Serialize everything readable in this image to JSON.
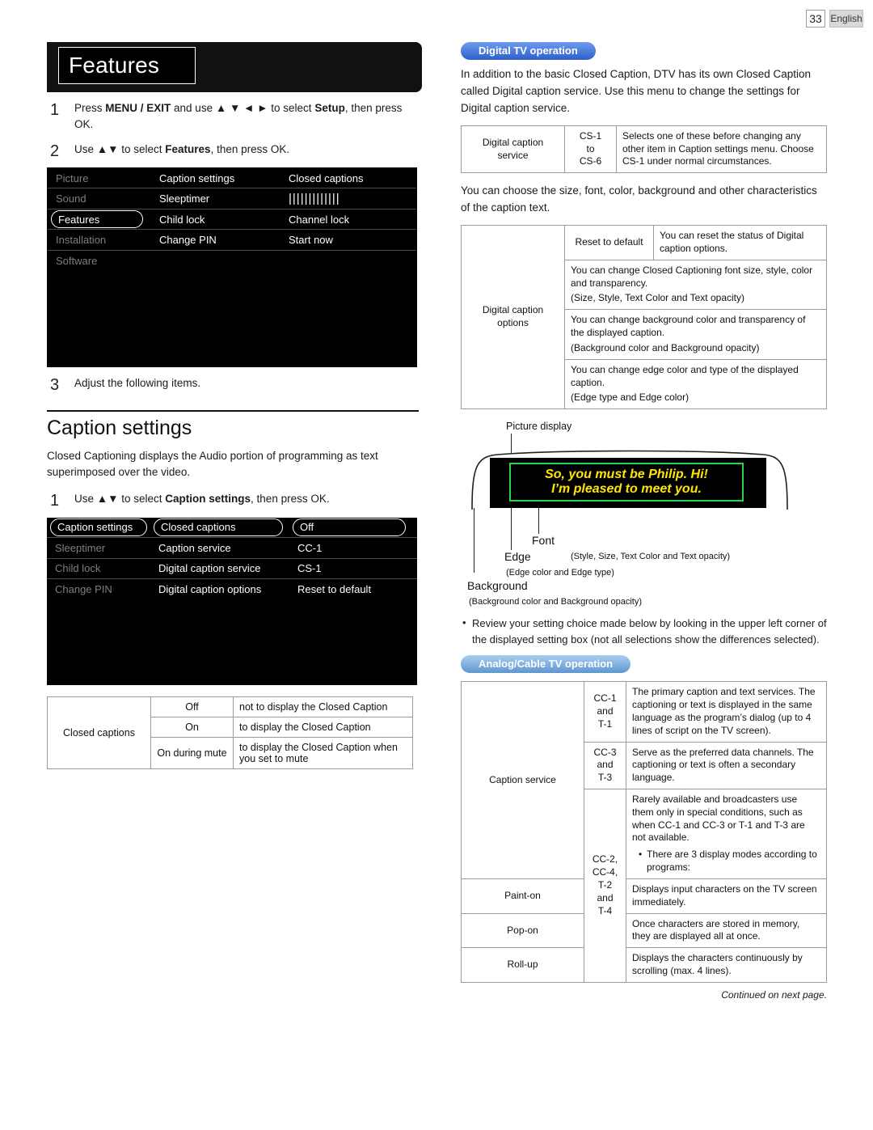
{
  "header": {
    "page_number": "33",
    "language": "English"
  },
  "left": {
    "banner_title": "Features",
    "steps": [
      {
        "num": "1",
        "text_parts": [
          "Press ",
          "MENU / EXIT",
          " and use ",
          "▲ ▼ ◄ ►",
          " to select ",
          "Setup",
          ", then press OK."
        ]
      },
      {
        "num": "2",
        "text_parts": [
          "Use ",
          "▲▼",
          " to select ",
          "Features",
          ", then press OK."
        ]
      },
      {
        "num": "3",
        "text": "Adjust the following items."
      }
    ],
    "step1_plain": "Press MENU / EXIT and use ▲ ▼ ◄ ► to select Setup, then press OK.",
    "step2_plain": "Use ▲▼ to select Features, then press OK.",
    "step3_plain": "Adjust the following items.",
    "menu1": {
      "col1": [
        "Picture",
        "Sound",
        "Features",
        "Installation",
        "Software"
      ],
      "col2": [
        "Caption settings",
        "Sleeptimer",
        "Child lock",
        "Change PIN"
      ],
      "col3": [
        "Closed captions",
        "|||||||||||||",
        "Channel lock",
        "Start now"
      ],
      "selected_col1": "Features",
      "selected_col3": "Closed captions"
    },
    "section_title": "Caption settings",
    "section_intro": "Closed Captioning displays the Audio portion of programming as text superimposed over the video.",
    "step_cs": {
      "num": "1",
      "text": "Use ▲▼ to select Caption settings, then press OK."
    },
    "menu2": {
      "col1": [
        "Caption settings",
        "Sleeptimer",
        "Child lock",
        "Change PIN"
      ],
      "col2": [
        "Closed captions",
        "Caption service",
        "Digital caption service",
        "Digital caption options"
      ],
      "col3": [
        "Off",
        "CC-1",
        "CS-1",
        "Reset to default"
      ],
      "selected_col1": "Caption settings",
      "selected_col2": "Closed captions",
      "selected_col3": "Off"
    },
    "table_closed_captions": {
      "row_label": "Closed captions",
      "rows": [
        {
          "option": "Off",
          "desc": "not to display the Closed Caption"
        },
        {
          "option": "On",
          "desc": "to display the Closed Caption"
        },
        {
          "option": "On during mute",
          "desc": "to display the Closed Caption when you set to mute"
        }
      ]
    }
  },
  "right": {
    "pill_digital": "Digital TV operation",
    "intro": "In addition to the basic Closed Caption, DTV has its own Closed Caption called Digital caption service. Use this menu to change the settings for Digital caption service.",
    "table_service": {
      "label": "Digital caption service",
      "value": "CS-1 to CS-6",
      "value_lines": [
        "CS-1",
        "to",
        "CS-6"
      ],
      "desc": "Selects one of these before changing any other item in Caption settings menu. Choose CS-1 under normal circumstances."
    },
    "mid_text": "You can choose the size, font, color, background and other characteristics of the caption text.",
    "table_options": {
      "label": "Digital caption options",
      "rows": [
        {
          "key": "Reset to default",
          "desc": "You can reset the status of Digital caption options.",
          "note": ""
        },
        {
          "key": "",
          "desc": "You can change Closed Captioning font size, style, color and transparency.",
          "note": "(Size, Style, Text Color and Text opacity)"
        },
        {
          "key": "",
          "desc": "You can change background color and transparency of the displayed caption.",
          "note": "(Background color and Background opacity)"
        },
        {
          "key": "",
          "desc": "You can change edge color and type of the displayed caption.",
          "note": "(Edge type and Edge color)"
        }
      ]
    },
    "diagram": {
      "title": "Picture display",
      "caption_line1": "So, you must be Philip. Hi!",
      "caption_line2": "I’m pleased to meet you.",
      "font_label": "Font",
      "font_note": "(Style, Size, Text Color and Text opacity)",
      "edge_label": "Edge",
      "edge_note": "(Edge color and Edge type)",
      "background_label": "Background",
      "background_note": "(Background color and Background opacity)"
    },
    "bullet_review": "Review your setting choice made below by looking in the upper left corner of the displayed setting box (not all selections show the differences selected).",
    "pill_analog": "Analog/Cable TV operation",
    "table_caption_service": {
      "label": "Caption service",
      "rows": [
        {
          "code_lines": [
            "CC-1",
            "and",
            "T-1"
          ],
          "desc": "The primary caption and text services. The captioning or text is displayed in the same language as the program’s dialog (up to 4 lines of script on the TV screen)."
        },
        {
          "code_lines": [
            "CC-3",
            "and",
            "T-3"
          ],
          "desc": "Serve as the preferred data channels. The captioning or text is often a secondary language."
        },
        {
          "code_lines": [
            "CC-2,",
            "CC-4,",
            "T-2",
            "and",
            "T-4"
          ],
          "desc": "Rarely available and broadcasters use them only in special conditions, such as when CC-1 and CC-3 or T-1 and T-3 are not available.",
          "sub_note": "There are 3 display modes according to programs:",
          "modes": [
            {
              "name": "Paint-on",
              "desc": "Displays input characters on the TV screen immediately."
            },
            {
              "name": "Pop-on",
              "desc": "Once characters are stored in memory, they are displayed all at once."
            },
            {
              "name": "Roll-up",
              "desc": "Displays the characters continuously by scrolling (max. 4 lines)."
            }
          ]
        }
      ]
    },
    "continued": "Continued on next page."
  }
}
